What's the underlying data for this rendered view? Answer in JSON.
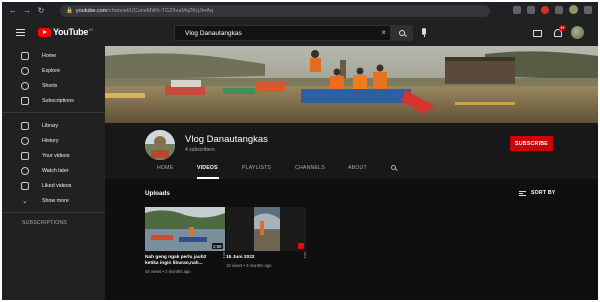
{
  "browser": {
    "url_host": "youtube.com",
    "url_path": "/channel/UCuneMWh-TGZ5vaMqZKrjJmAq"
  },
  "topbar": {
    "logo_text": "YouTube",
    "logo_region": "ID",
    "search_value": "Vlog Danautangkas",
    "notifications_badge": "9+"
  },
  "sidebar": {
    "items": [
      {
        "label": "Home",
        "icon": "home-icon"
      },
      {
        "label": "Explore",
        "icon": "explore-icon"
      },
      {
        "label": "Shorts",
        "icon": "shorts-icon"
      },
      {
        "label": "Subscriptions",
        "icon": "subscriptions-icon"
      },
      {
        "label": "Library",
        "icon": "library-icon"
      },
      {
        "label": "History",
        "icon": "history-icon"
      },
      {
        "label": "Your videos",
        "icon": "your-videos-icon"
      },
      {
        "label": "Watch later",
        "icon": "watch-later-icon"
      },
      {
        "label": "Liked videos",
        "icon": "liked-videos-icon"
      },
      {
        "label": "Show more",
        "icon": "chevron-down-icon"
      }
    ],
    "subscriptions_heading": "SUBSCRIPTIONS"
  },
  "channel": {
    "name": "Vlog Danautangkas",
    "subscribers": "4 subscribers",
    "subscribe_label": "SUBSCRIBE"
  },
  "tabs": [
    {
      "label": "HOME",
      "active": false
    },
    {
      "label": "VIDEOS",
      "active": true
    },
    {
      "label": "PLAYLISTS",
      "active": false
    },
    {
      "label": "CHANNELS",
      "active": false
    },
    {
      "label": "ABOUT",
      "active": false
    }
  ],
  "content": {
    "section_title": "Uploads",
    "sort_label": "SORT BY",
    "videos": [
      {
        "title": "Nah geng ngak perlu jauh2 ketika ingin liburan,nah...",
        "meta": "34 views • 2 months ago",
        "duration": "2:59"
      },
      {
        "title": "15 Juni 2022",
        "meta": "15 views • 3 months ago",
        "duration": ""
      }
    ]
  },
  "colors": {
    "accent": "#cc0000",
    "background": "#0f0f0f",
    "sidebar": "#212121"
  }
}
